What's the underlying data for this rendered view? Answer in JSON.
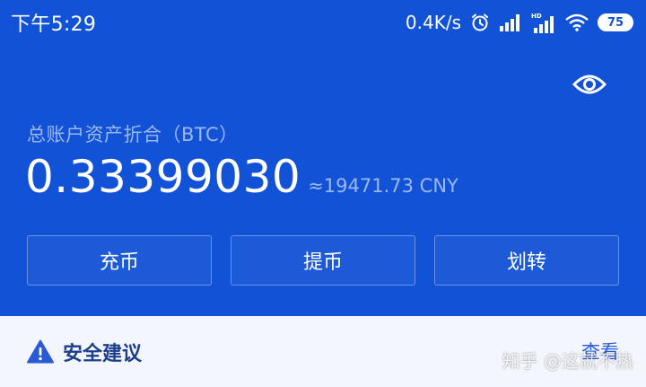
{
  "status_bar": {
    "time": "下午5:29",
    "net_speed": "0.4K/s",
    "battery": "75",
    "icons": [
      "alarm-icon",
      "signal-icon",
      "signal-hd-icon",
      "wifi-icon",
      "battery-icon"
    ]
  },
  "header": {
    "eye_icon": "eye-icon"
  },
  "balance": {
    "label": "总账户资产折合（BTC）",
    "value": "0.33399030",
    "fiat": "≈19471.73 CNY"
  },
  "actions": {
    "deposit": "充币",
    "withdraw": "提币",
    "transfer": "划转"
  },
  "advice": {
    "label": "安全建议",
    "view": "查看",
    "icon": "warning-icon"
  },
  "watermark": "知乎 @这就不热",
  "colors": {
    "background": "#1152d6",
    "advice_bg": "#f3f6fd",
    "advice_text": "#1d3e8a",
    "link": "#2a5bd7",
    "muted_text": "#9db7ef"
  }
}
